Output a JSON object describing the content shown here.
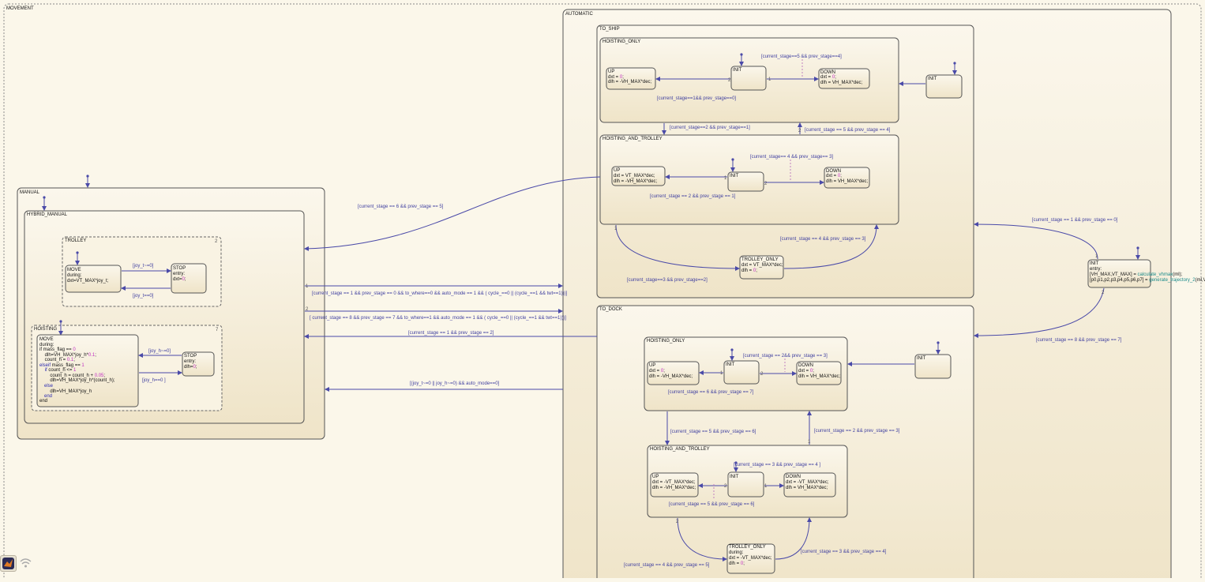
{
  "colors": {
    "state_fill": "#f8f1de",
    "state_stroke": "#555555",
    "transition": "#4a4aa8",
    "label": "#3f3fa0",
    "magenta": "#c22ec2",
    "teal": "#1a8a8a"
  },
  "states": {
    "movement": "MOVEMENT",
    "manual": "MANUAL",
    "hybrid_manual": "HYBRID_MANUAL",
    "trolley": "TROLLEY",
    "trolley_move": [
      "MOVE",
      "during:",
      "dxt=VT_MAX*joy_t;"
    ],
    "trolley_stop": [
      "STOP",
      "entry:",
      "dxt=0;"
    ],
    "hoisting": "HOISTING",
    "hoisting_move": [
      "MOVE",
      "during:",
      "if mass_flag == 0",
      "    dlh=VH_MAX*joy_h*0.1;",
      "    count_h = 0.1;",
      "elseif mass_flag == 1",
      "    if count_h <= 1",
      "        count_h = count_h + 0.05;",
      "        dlh=VH_MAX*joy_h*(count_h);",
      "    else",
      "        dlh=VH_MAX*joy_h",
      "    end",
      "end"
    ],
    "hoisting_stop": [
      "STOP",
      "entry:",
      "dlh=0;"
    ],
    "automatic": "AUTOMATIC",
    "to_ship": "TO_SHIP",
    "to_dock": "TO_DOCK",
    "hoisting_only": "HOISTING_ONLY",
    "hoisting_and_trolley": "HOISTING_AND_TROLLEY",
    "init": "INIT",
    "ship_ho_up": [
      "UP",
      "dxt = 0;",
      "dlh = -VH_MAX*dec;"
    ],
    "ship_ho_down": [
      "DOWN",
      "dxt = 0;",
      "dlh = VH_MAX*dec;"
    ],
    "ship_ht_up": [
      "UP",
      "dxt = VT_MAX*dec;",
      "dlh = -VH_MAX*dec;"
    ],
    "ship_ht_down": [
      "DOWN",
      "dxt = 0;",
      "dlh = VH_MAX*dec;"
    ],
    "ship_to": [
      "TROLLEY_ONLY",
      "dxt = VT_MAX*dec;",
      "dlh = 0;"
    ],
    "dock_ho_up": [
      "UP",
      "dxt = 0;",
      "dlh = -VH_MAX*dec;"
    ],
    "dock_ho_down": [
      "DOWN",
      "dxt = 0;",
      "dlh = VH_MAX*dec;"
    ],
    "dock_ht_up": [
      "UP",
      "dxt = -VT_MAX*dec;",
      "dlh = -VH_MAX*dec;"
    ],
    "dock_ht_down": [
      "DOWN",
      "dxt = -VT_MAX*dec;",
      "dlh = VH_MAX*dec;"
    ],
    "dock_to": [
      "TROLLEY_ONLY",
      "during:",
      "dxt = -VT_MAX*dec;",
      "dlh = 0;"
    ],
    "auto_init": [
      "INIT",
      "entry:",
      "[VH_MAX,VT_MAX] = calculate_vhmax(ml);",
      "[p0,p1,p2,p3,p4,p5,p6,p7] = generate_trajectory_2(ml,V"
    ]
  },
  "transitions": {
    "joy_t_ne": "[joy_t~=0]",
    "joy_t_eq": "[joy_t==0]",
    "joy_h_ne": "[joy_h~=0]",
    "joy_h_eq": "[joy_h==0 ]",
    "s6p5": "[current_stage == 6 && prev_stage == 5]",
    "to_auto_1": "[current_stage ==  1 && prev_stage == 0 && to_where==0 && auto_mode == 1 && ( cycle_==0 || (cycle_==1 && twt==1)))]",
    "to_auto_2": "[ current_stage == 8 && prev_stage == 7 && to_where==1 && auto_mode == 1 && ( cycle_==0 || (cycle_==1 && twt==1)))]",
    "s1p2": "[current_stage == 1 && prev_stage == 2]",
    "joy_auto": "[(joy_t~=0 || joy_h~=0) && auto_mode==0]",
    "ship_s5p4": "[current_stage==5 && prev_stage==4]",
    "ship_s1p0": "[current_stage==1&& prev_stage==0]",
    "ship_s2p1": "[current_stage==2 && prev_stage==1]",
    "ship_s5p4b": "[current_stage == 5 && prev_stage == 4]",
    "ship_s4p3": "[current_stage== 4 && prev_stage== 3]",
    "ship_s2p1b": "[current_stage == 2 && prev_stage == 1]",
    "ship_s4p3b": "[current_stage == 4 && prev_stage == 3]",
    "ship_s3p2": "[current_stage==3 && prev_stage==2]",
    "auto_s1p0": "[current_stage == 1 && prev_stage == 0]",
    "auto_s8p7": "[current_stage == 8 && prev_stage == 7]",
    "dock_s2p3": "[current_stage == 2&& prev_stage == 3]",
    "dock_s6p7": "[current_stage == 6 && prev_stage == 7]",
    "dock_s5p6": "[current_stage == 5 && prev_stage == 6]",
    "dock_s2p3b": "[current_stage == 2 && prev_stage == 3]",
    "dock_s3p4": "[current_stage == 3 && prev_stage == 4 ]",
    "dock_s5p6b": "[current_stage == 5 && prev_stage == 6]",
    "dock_s3p4b": "[current_stage == 3 && prev_stage == 4]",
    "dock_s4p5": "[current_stage == 4 && prev_stage == 5]"
  },
  "numbers": {
    "one": "1",
    "two": "2"
  },
  "toolbar": {
    "matlab_icon": "matlab-logo-icon",
    "signal_icon": "signal-icon"
  }
}
